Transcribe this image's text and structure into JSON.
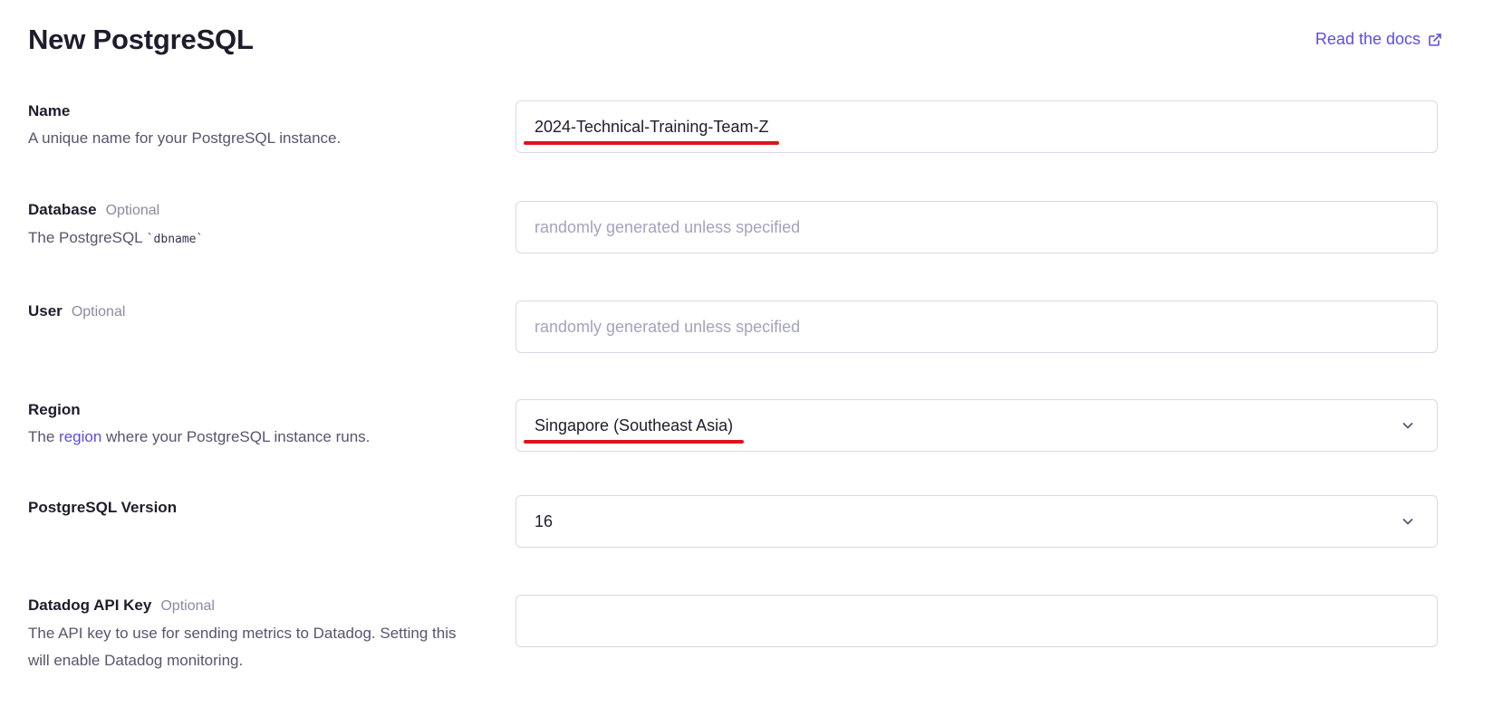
{
  "page": {
    "title": "New PostgreSQL",
    "docs_link": "Read the docs"
  },
  "fields": {
    "name": {
      "label": "Name",
      "description": "A unique name for your PostgreSQL instance.",
      "value": "2024-Technical-Training-Team-Z"
    },
    "database": {
      "label": "Database",
      "optional": "Optional",
      "description_prefix": "The PostgreSQL ",
      "description_code": "`dbname`",
      "placeholder": "randomly generated unless specified"
    },
    "user": {
      "label": "User",
      "optional": "Optional",
      "placeholder": "randomly generated unless specified"
    },
    "region": {
      "label": "Region",
      "description_prefix": "The ",
      "description_link": "region",
      "description_suffix": " where your PostgreSQL instance runs.",
      "value": "Singapore (Southeast Asia)"
    },
    "version": {
      "label": "PostgreSQL Version",
      "value": "16"
    },
    "datadog": {
      "label": "Datadog API Key",
      "optional": "Optional",
      "description": "The API key to use for sending metrics to Datadog. Setting this will enable Datadog monitoring.",
      "value": ""
    }
  },
  "colors": {
    "accent": "#5b4ee0",
    "annotation": "#e0121c",
    "border": "#d9d9e6"
  }
}
